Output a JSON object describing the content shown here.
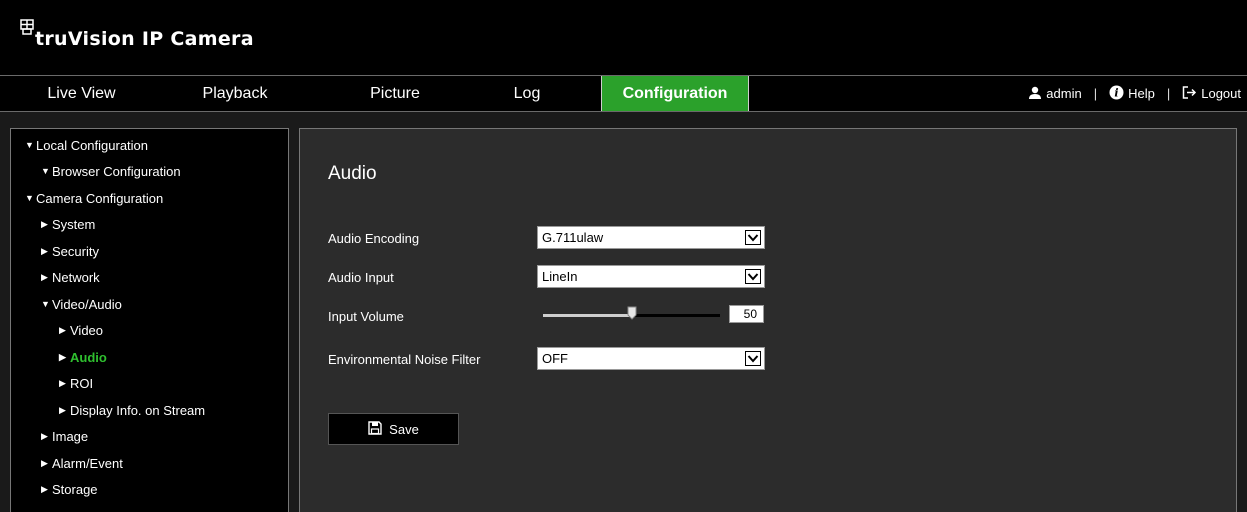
{
  "header": {
    "brand": "truVision  IP Camera"
  },
  "nav": {
    "tabs": [
      {
        "label": "Live View"
      },
      {
        "label": "Playback"
      },
      {
        "label": "Picture"
      },
      {
        "label": "Log"
      },
      {
        "label": "Configuration"
      }
    ],
    "active_tab": "Configuration",
    "user": {
      "username": "admin",
      "help": "Help",
      "logout": "Logout",
      "separator": "|"
    }
  },
  "sidebar": {
    "items": [
      {
        "label": "Local Configuration",
        "expanded": true,
        "level": 0
      },
      {
        "label": "Browser Configuration",
        "expanded": true,
        "level": 1
      },
      {
        "label": "Camera Configuration",
        "expanded": true,
        "level": 0
      },
      {
        "label": "System",
        "expanded": false,
        "level": 1
      },
      {
        "label": "Security",
        "expanded": false,
        "level": 1
      },
      {
        "label": "Network",
        "expanded": false,
        "level": 1
      },
      {
        "label": "Video/Audio",
        "expanded": true,
        "level": 1
      },
      {
        "label": "Video",
        "expanded": false,
        "level": 2
      },
      {
        "label": "Audio",
        "expanded": false,
        "level": 2,
        "active": true
      },
      {
        "label": "ROI",
        "expanded": false,
        "level": 2
      },
      {
        "label": "Display Info. on Stream",
        "expanded": false,
        "level": 2
      },
      {
        "label": "Image",
        "expanded": false,
        "level": 1
      },
      {
        "label": "Alarm/Event",
        "expanded": false,
        "level": 1
      },
      {
        "label": "Storage",
        "expanded": false,
        "level": 1
      }
    ]
  },
  "main": {
    "title": "Audio",
    "fields": {
      "audio_encoding": {
        "label": "Audio Encoding",
        "value": "G.711ulaw"
      },
      "audio_input": {
        "label": "Audio Input",
        "value": "LineIn"
      },
      "input_volume": {
        "label": "Input Volume",
        "value": "50",
        "level_fraction": 0.5
      },
      "noise_filter": {
        "label": "Environmental Noise Filter",
        "value": "OFF"
      }
    },
    "save_label": "Save"
  },
  "colors": {
    "accent": "#2ba12b",
    "active_text": "#2fbf2f",
    "panel_bg": "#2c2c2c",
    "header_bg": "#000000"
  },
  "icons": {
    "user": "user-icon",
    "help": "help-icon",
    "logout": "logout-icon",
    "save": "floppy-disk-icon",
    "logo": "logo-mark-icon"
  }
}
